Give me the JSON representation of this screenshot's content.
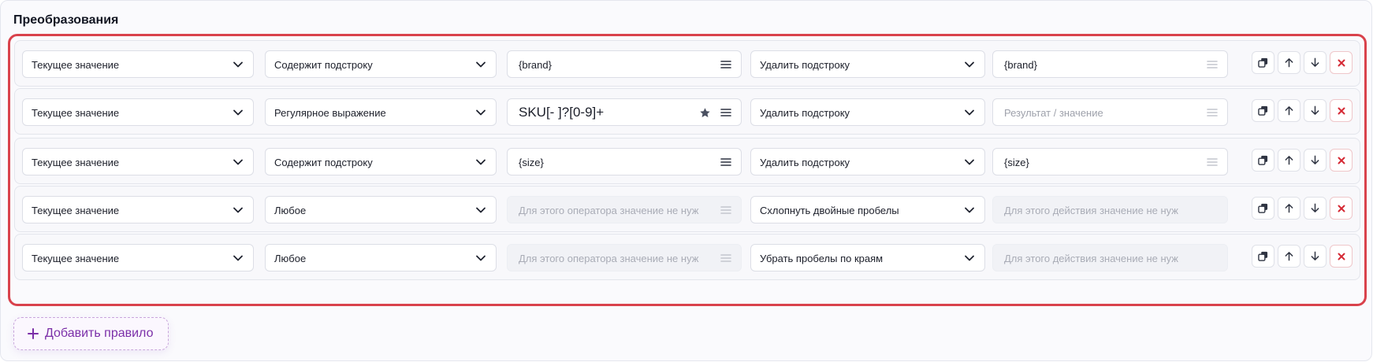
{
  "section": {
    "title": "Преобразования"
  },
  "rules": [
    {
      "source": "Текущее значение",
      "operator": "Содержит подстроку",
      "pattern": {
        "value": "{brand}",
        "placeholder": "",
        "disabled": false,
        "big": false,
        "starred": false
      },
      "action": "Удалить подстроку",
      "result": {
        "value": "{brand}",
        "placeholder": "",
        "disabled": false
      }
    },
    {
      "source": "Текущее значение",
      "operator": "Регулярное выражение",
      "pattern": {
        "value": "SKU[- ]?[0-9]+",
        "placeholder": "",
        "disabled": false,
        "big": true,
        "starred": true
      },
      "action": "Удалить подстроку",
      "result": {
        "value": "",
        "placeholder": "Результат / значение",
        "disabled": false
      }
    },
    {
      "source": "Текущее значение",
      "operator": "Содержит подстроку",
      "pattern": {
        "value": "{size}",
        "placeholder": "",
        "disabled": false,
        "big": false,
        "starred": false
      },
      "action": "Удалить подстроку",
      "result": {
        "value": "{size}",
        "placeholder": "",
        "disabled": false
      }
    },
    {
      "source": "Текущее значение",
      "operator": "Любое",
      "pattern": {
        "value": "",
        "placeholder": "Для этого оператора значение не нуж",
        "disabled": true,
        "big": false,
        "starred": false
      },
      "action": "Схлопнуть двойные пробелы",
      "result": {
        "value": "",
        "placeholder": "Для этого действия значение не нуж",
        "disabled": true
      }
    },
    {
      "source": "Текущее значение",
      "operator": "Любое",
      "pattern": {
        "value": "",
        "placeholder": "Для этого оператора значение не нуж",
        "disabled": true,
        "big": false,
        "starred": false
      },
      "action": "Убрать пробелы по краям",
      "result": {
        "value": "",
        "placeholder": "Для этого действия значение не нуж",
        "disabled": true
      }
    }
  ],
  "row_buttons": [
    "copy-icon",
    "arrow-up-icon",
    "arrow-down-icon",
    "close-icon"
  ],
  "add_rule": {
    "label": "Добавить правило"
  },
  "colors": {
    "highlight": "#d9424c",
    "delete": "#d52a35",
    "add_accent": "#7b2fa8"
  }
}
